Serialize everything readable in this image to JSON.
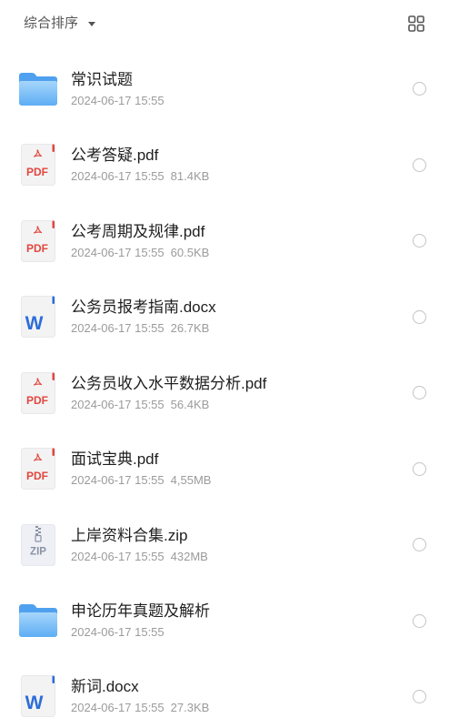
{
  "toolbar": {
    "sort_label": "综合排序",
    "sort_icon": "caret-down-icon",
    "view_toggle_icon": "grid-view-icon"
  },
  "icon_labels": {
    "pdf": "PDF",
    "word": "W",
    "zip": "ZIP"
  },
  "files": [
    {
      "icon": "folder-icon",
      "name": "常识试题",
      "date": "2024-06-17 15:55",
      "selected": false
    },
    {
      "icon": "pdf-file-icon",
      "name": "公考答疑.pdf",
      "date": "2024-06-17 15:55",
      "size": "81.4KB",
      "selected": false
    },
    {
      "icon": "pdf-file-icon",
      "name": "公考周期及规律.pdf",
      "date": "2024-06-17 15:55",
      "size": "60.5KB",
      "selected": false
    },
    {
      "icon": "word-file-icon",
      "name": "公务员报考指南.docx",
      "date": "2024-06-17 15:55",
      "size": "26.7KB",
      "selected": false
    },
    {
      "icon": "pdf-file-icon",
      "name": "公务员收入水平数据分析.pdf",
      "date": "2024-06-17 15:55",
      "size": "56.4KB",
      "selected": false
    },
    {
      "icon": "pdf-file-icon",
      "name": "面试宝典.pdf",
      "date": "2024-06-17 15:55",
      "size": "4,55MB",
      "selected": false
    },
    {
      "icon": "zip-file-icon",
      "name": "上岸资料合集.zip",
      "date": "2024-06-17 15:55",
      "size": "432MB",
      "selected": false
    },
    {
      "icon": "folder-icon",
      "name": "申论历年真题及解析",
      "date": "2024-06-17 15:55",
      "selected": false
    },
    {
      "icon": "word-file-icon",
      "name": "新词.docx",
      "date": "2024-06-17 15:55",
      "size": "27.3KB",
      "selected": false
    }
  ],
  "colors": {
    "background": "#ffffff",
    "header_text": "#555555",
    "name_text": "#1f1f1f",
    "meta_text": "#9b9b9b",
    "folder": "#4fa1ef",
    "pdf": "#e2473f",
    "word": "#2c6dd8",
    "zip": "#8b94a8",
    "radio_border": "#c4c4c4"
  }
}
